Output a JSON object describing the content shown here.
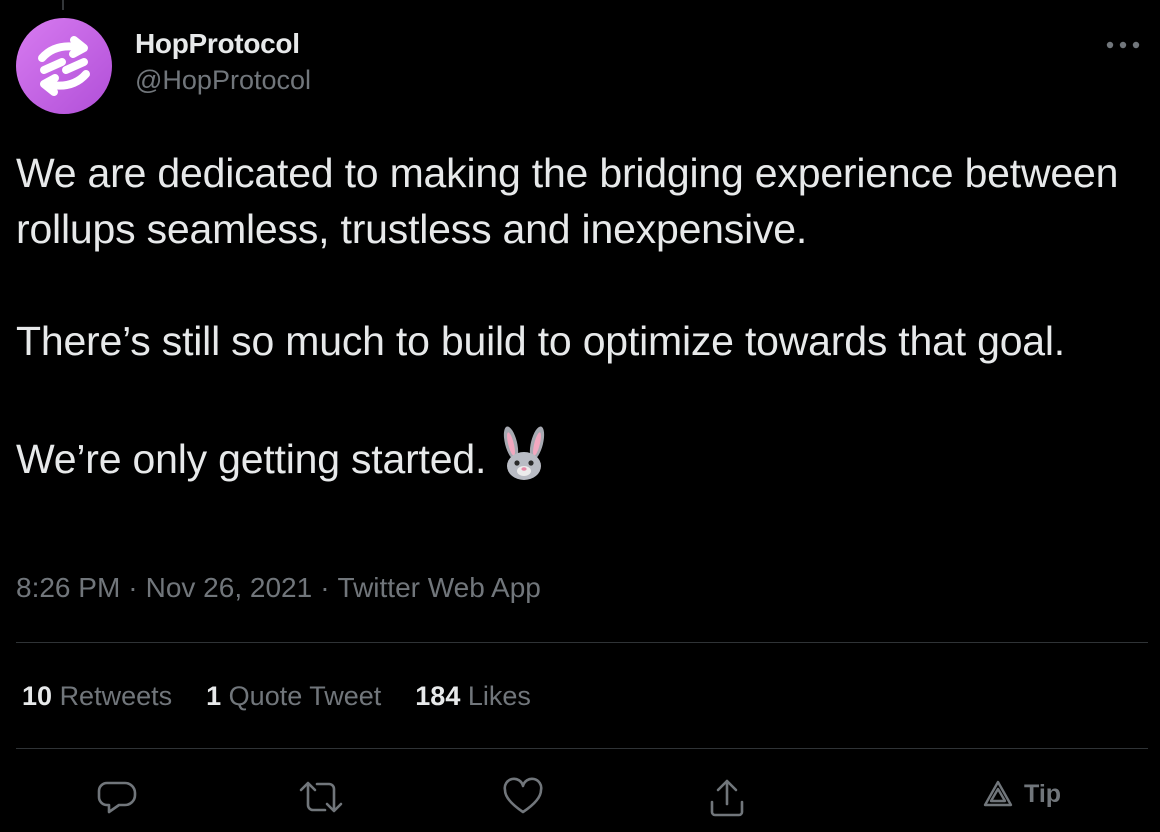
{
  "author": {
    "display_name": "HopProtocol",
    "handle": "@HopProtocol",
    "avatar_icon": "hop-protocol-logo",
    "avatar_color": "#c466e6"
  },
  "tweet": {
    "paragraphs": [
      "We are dedicated to making the bridging experience between rollups seamless, trustless and inexpensive.",
      "There’s still so much to build to optimize towards that goal.",
      "We’re only getting started."
    ],
    "emoji": "rabbit-face"
  },
  "meta": {
    "time": "8:26 PM",
    "date": "Nov 26, 2021",
    "source": "Twitter Web App",
    "separator": "·"
  },
  "stats": {
    "retweets": {
      "count": "10",
      "label": "Retweets"
    },
    "quotes": {
      "count": "1",
      "label": "Quote Tweet"
    },
    "likes": {
      "count": "184",
      "label": "Likes"
    }
  },
  "actions": {
    "reply_icon": "reply-icon",
    "retweet_icon": "retweet-icon",
    "like_icon": "heart-icon",
    "share_icon": "share-icon",
    "tip_label": "Tip"
  },
  "colors": {
    "background": "#000000",
    "text": "#e7e9ea",
    "secondary": "#71767b",
    "divider": "#2f3336"
  }
}
